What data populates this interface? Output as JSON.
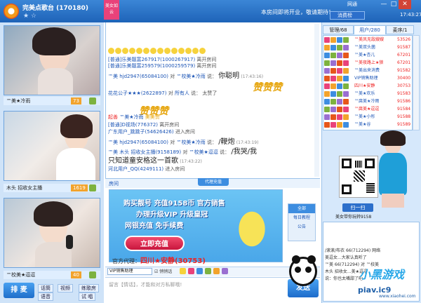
{
  "titlebar": {
    "title": "完美点歌台 (170180)",
    "notice": "本房间即将开业，敬请期待！",
    "tag": "美女如云",
    "network": "网通",
    "msg_button": "消费榜",
    "clock": "17:43:27",
    "min": "—",
    "max": "□",
    "close": "✕",
    "star": "★ ☆"
  },
  "videos": [
    {
      "name": "™美★冷雨",
      "count": "73"
    },
    {
      "name": "木头 招收女主播",
      "count": "1619"
    },
    {
      "name": "™校美★逗逗",
      "count": "40"
    }
  ],
  "leftbar": {
    "paimai": "排 麦",
    "btn1": "话筒",
    "btn2": "语音",
    "btn3": "视频",
    "btn4": "试 唱",
    "btn5": "练歌房"
  },
  "chat": {
    "lines": [
      {
        "user": "[普通]乐美靓富267917(1000267917)",
        "text": "离开房间"
      },
      {
        "user": "[普通]乐美靓富259579(1000259579)",
        "text": "离开房间"
      },
      {
        "user": "™美 hjd2947(65084100)",
        "to": "对",
        "target": "™校美★冷雨",
        "say": "说：",
        "msg": "你聪明",
        "time": "(17:43:16)"
      },
      {
        "user": "花花公子★★★(2622897)",
        "to": "对",
        "target": "所有人",
        "say": "说：",
        "msg": "太赞了",
        "time": ""
      },
      {
        "label": "起善",
        "user": "™美★冷雨",
        "target": "美美赞"
      },
      {
        "user": "[普通]D视场(776372)",
        "text": "离开房间"
      },
      {
        "user": "广东用户_跳跳子(54626426)",
        "text": "进入房间"
      },
      {
        "user": "™美 hjd2947(65084100)",
        "to": "对",
        "target": "™校美★冷雨",
        "say": "说：",
        "msg": "/鞭炮",
        "time": "(17:43:19)"
      },
      {
        "user": "™美 木头 招收女主播(9158189)",
        "to": "对",
        "target": "™校美★逗逗",
        "say": "说：",
        "msg": "/我哭/我",
        "time": ""
      },
      {
        "msg": "只知道童安格这一首歌",
        "time": "(17:43:22)"
      },
      {
        "user": "河北用户_QQ(4249111)",
        "text": "进入房间"
      }
    ],
    "zan": "赞赞赞",
    "zan2": "赞赞赞"
  },
  "ad": {
    "head_label": "房间",
    "title": "代理充值",
    "line1": "购买靓号 充值9158币 官方销售",
    "line2": "办理升级VIP 升级皇冠",
    "line3": "网银充值 免手续费",
    "button": "立即充值",
    "bottom_prefix": "官方代理：",
    "bottom_name": "四川★安静",
    "bottom_num": "(30753)",
    "side": [
      "全部",
      "每日教程",
      "公告"
    ]
  },
  "toolbar": {
    "select": "VIP销售助理",
    "check": "悄悄话"
  },
  "input": {
    "placeholder": "留言【情话】，才能和对方私聊哦!",
    "send": "发送"
  },
  "right": {
    "tabs": [
      "管理/68",
      "用户/280",
      "麦序/1"
    ],
    "users": [
      {
        "name": "™美凤无敌嫂嫂",
        "num": "53526"
      },
      {
        "name": "™美双头菌",
        "num": "91587"
      },
      {
        "name": "™美★杏儿",
        "num": "67201"
      },
      {
        "name": "™美夜路上★狼",
        "num": "67201"
      },
      {
        "name": "™美出来消费",
        "num": "91582"
      },
      {
        "name": "VIP销售助理",
        "num": "30400"
      },
      {
        "name": "四川★安静",
        "num": "30753"
      },
      {
        "name": "™美★欢乐",
        "num": "91583"
      },
      {
        "name": "™腐美★冷雨",
        "num": "91586"
      },
      {
        "name": "™腐美★逗逗",
        "num": "91584"
      },
      {
        "name": "™美★小彤",
        "num": "91588"
      },
      {
        "name": "™美★谷",
        "num": "91589"
      }
    ],
    "qr_button": "扫一扫",
    "qr_caption": "美女带你玩转9158",
    "private": [
      "/滚滚/布衣 66(712294) 网络",
      "美逗女...大家认真听了",
      "™美 66(712294) 对 ™校美",
      "木头 招收女...美★逗逗",
      "说：你也太嘴甜了吧"
    ]
  },
  "watermark": {
    "text": "小黑游戏",
    "url": "piav.ic9",
    "sub": "www.xiaohei.com"
  },
  "colors": {
    "titlebar": "#1e63b8",
    "accent": "#2c6fcb",
    "pink": "#e9427a",
    "gold": "#e6a40a",
    "send": "#1d6ccb"
  }
}
